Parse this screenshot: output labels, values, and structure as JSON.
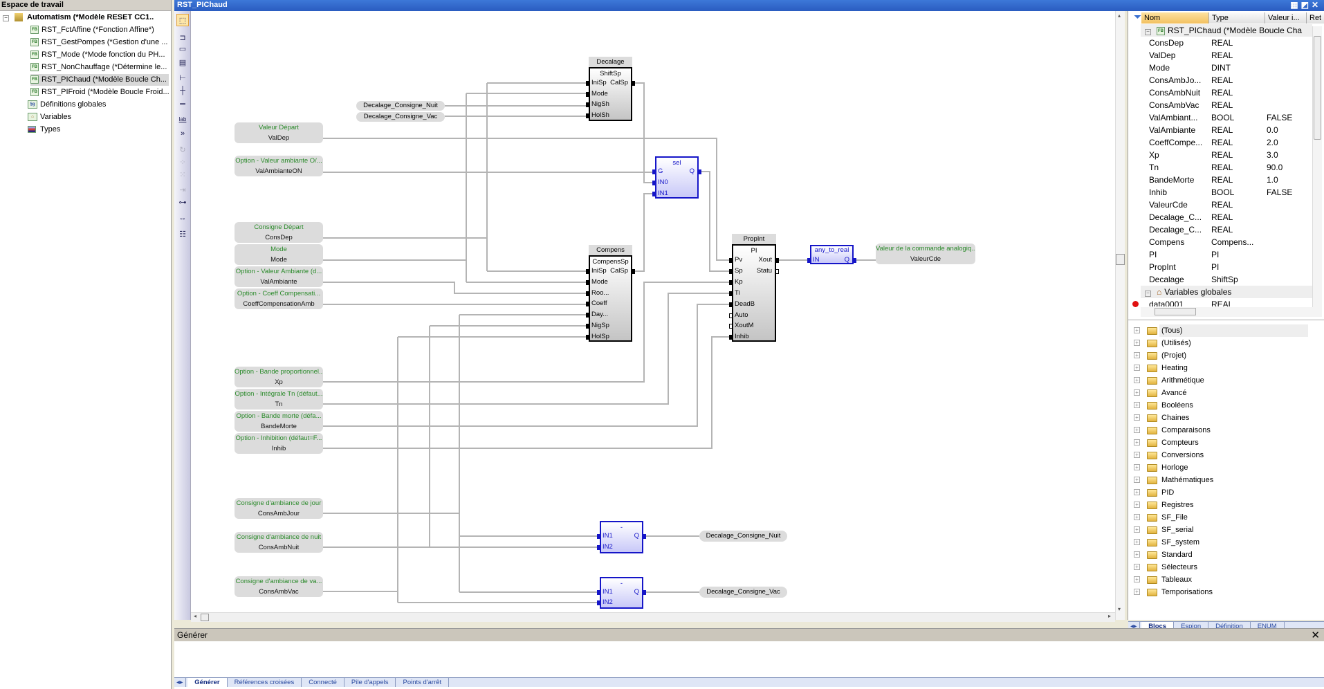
{
  "workspace": {
    "title": "Espace de travail",
    "root": "Automatism (*Modèle RESET CC1..",
    "items": [
      {
        "label": "RST_FctAffine (*Fonction Affine*)",
        "icon": "fb-icon"
      },
      {
        "label": "RST_GestPompes (*Gestion d'une ...",
        "icon": "fb-icon"
      },
      {
        "label": "RST_Mode (*Mode fonction du PH...",
        "icon": "fb-icon"
      },
      {
        "label": "RST_NonChauffage (*Détermine le...",
        "icon": "fb-icon"
      },
      {
        "label": "RST_PIChaud (*Modèle Boucle Ch...",
        "icon": "fb-key-icon",
        "selected": true
      },
      {
        "label": "RST_PIFroid (*Modèle Boucle Froid...",
        "icon": "fb-icon"
      },
      {
        "label": "Définitions globales",
        "icon": "sg-icon"
      },
      {
        "label": "Variables",
        "icon": "house-icon"
      },
      {
        "label": "Types",
        "icon": "types-icon"
      }
    ]
  },
  "editor": {
    "title": "RST_PIChaud",
    "tools": [
      "select-icon",
      "block-icon",
      "variable-icon",
      "comment-icon",
      "contact-icon",
      "junction-icon",
      "rung-icon",
      "label-icon",
      "jump-icon",
      "loop-icon",
      "network-icon",
      "grid-icon",
      "connect-icon",
      "autoroute-icon",
      "spacing-icon",
      "properties-icon"
    ]
  },
  "diagram": {
    "inputs": [
      {
        "comment": "Valeur Départ",
        "name": "ValDep"
      },
      {
        "comment": "Option - Valeur ambiante O/...",
        "name": "ValAmbianteON"
      },
      {
        "comment": "Consigne Départ",
        "name": "ConsDep"
      },
      {
        "comment": "Mode",
        "name": "Mode"
      },
      {
        "comment": "Option - Valeur Ambiante (d...",
        "name": "ValAmbiante"
      },
      {
        "comment": "Option - Coeff Compensati...",
        "name": "CoeffCompensationAmb"
      },
      {
        "comment": "Option - Bande proportionnel...",
        "name": "Xp"
      },
      {
        "comment": "Option - Intégrale Tn (défaut...",
        "name": "Tn"
      },
      {
        "comment": "Option - Bande morte (défa...",
        "name": "BandeMorte"
      },
      {
        "comment": "Option - Inhibition (défaut=F...",
        "name": "Inhib"
      },
      {
        "comment": "Consigne d'ambiance de jour",
        "name": "ConsAmbJour"
      },
      {
        "comment": "Consigne d'ambiance de nuit",
        "name": "ConsAmbNuit"
      },
      {
        "comment": "Consigne d'ambiance de va...",
        "name": "ConsAmbVac"
      }
    ],
    "feedback_vars": [
      "Decalage_Consigne_Nuit",
      "Decalage_Consigne_Vac"
    ],
    "blocks": [
      {
        "instance": "Decalage",
        "type": "ShiftSp",
        "inputs": [
          "IniSp",
          "Mode",
          "NigSh",
          "HolSh"
        ],
        "outputs": [
          "CalSp"
        ]
      },
      {
        "instance": "",
        "type": "sel",
        "inputs": [
          "G",
          "IN0",
          "IN1"
        ],
        "outputs": [
          "Q"
        ]
      },
      {
        "instance": "Compens",
        "type": "CompensSp",
        "inputs": [
          "IniSp",
          "Mode",
          "Roo...",
          "Coeff",
          "Day...",
          "NigSp",
          "HolSp"
        ],
        "outputs": [
          "CalSp"
        ]
      },
      {
        "instance": "PropInt",
        "type": "PI",
        "inputs": [
          "Pv",
          "Sp",
          "Kp",
          "Ti",
          "DeadB",
          "Auto",
          "XoutM",
          "Inhib"
        ],
        "outputs": [
          "Xout",
          "Statu"
        ]
      },
      {
        "instance": "",
        "type": "any_to_real",
        "inputs": [
          "IN"
        ],
        "outputs": [
          "Q"
        ]
      },
      {
        "instance": "",
        "type": "-",
        "inputs": [
          "IN1",
          "IN2"
        ],
        "outputs": [
          "Q"
        ]
      },
      {
        "instance": "",
        "type": "-",
        "inputs": [
          "IN1",
          "IN2"
        ],
        "outputs": [
          "Q"
        ]
      }
    ],
    "outputs": [
      {
        "comment": "Valeur de la commande analogiq...",
        "name": "ValeurCde"
      },
      {
        "comment": "",
        "name": "Decalage_Consigne_Nuit"
      },
      {
        "comment": "",
        "name": "Decalage_Consigne_Vac"
      }
    ]
  },
  "variables": {
    "columns": [
      "Nom",
      "Type",
      "Valeur i...",
      "Ret"
    ],
    "group": "RST_PIChaud (*Modèle Boucle Cha",
    "rows": [
      [
        "ConsDep",
        "REAL",
        ""
      ],
      [
        "ValDep",
        "REAL",
        ""
      ],
      [
        "Mode",
        "DINT",
        ""
      ],
      [
        "ConsAmbJo...",
        "REAL",
        ""
      ],
      [
        "ConsAmbNuit",
        "REAL",
        ""
      ],
      [
        "ConsAmbVac",
        "REAL",
        ""
      ],
      [
        "ValAmbiant...",
        "BOOL",
        "FALSE"
      ],
      [
        "ValAmbiante",
        "REAL",
        "0.0"
      ],
      [
        "CoeffCompe...",
        "REAL",
        "2.0"
      ],
      [
        "Xp",
        "REAL",
        "3.0"
      ],
      [
        "Tn",
        "REAL",
        "90.0"
      ],
      [
        "BandeMorte",
        "REAL",
        "1.0"
      ],
      [
        "Inhib",
        "BOOL",
        "FALSE"
      ],
      [
        "ValeurCde",
        "REAL",
        ""
      ],
      [
        "Decalage_C...",
        "REAL",
        ""
      ],
      [
        "Decalage_C...",
        "REAL",
        ""
      ],
      [
        "Compens",
        "Compens...",
        ""
      ],
      [
        "PI",
        "PI",
        ""
      ],
      [
        "PropInt",
        "PI",
        ""
      ],
      [
        "Decalage",
        "ShiftSp",
        ""
      ]
    ],
    "group2": "Variables globales",
    "partial_row": [
      "data0001",
      "REAL",
      ""
    ]
  },
  "library": {
    "folders": [
      "(Tous)",
      "(Utilisés)",
      "(Projet)",
      "Heating",
      "Arithmétique",
      "Avancé",
      "Booléens",
      "Chaines",
      "Comparaisons",
      "Compteurs",
      "Conversions",
      "Horloge",
      "Mathématiques",
      "PID",
      "Registres",
      "SF_File",
      "SF_serial",
      "SF_system",
      "Standard",
      "Sélecteurs",
      "Tableaux",
      "Temporisations"
    ],
    "tabs": [
      "Blocs",
      "Espion",
      "Définition",
      "ENUM"
    ],
    "active_tab": "Blocs"
  },
  "output_panel": {
    "title": "Générer",
    "tabs": [
      "Générer",
      "Références croisées",
      "Connecté",
      "Pile d'appels",
      "Points d'arrêt"
    ],
    "active_tab": "Générer"
  },
  "colors": {
    "title_bar": "#2a5cc0",
    "comment_text": "#2a8a2a",
    "std_block_border": "#1515c8",
    "wire": "#b4b4b4"
  }
}
